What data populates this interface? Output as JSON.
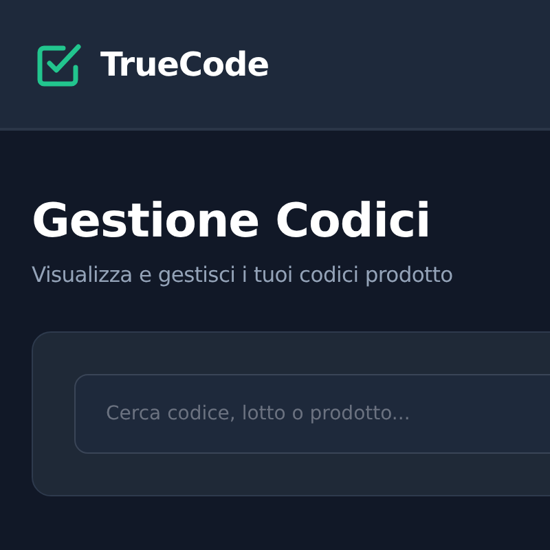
{
  "header": {
    "brand": "TrueCode"
  },
  "page": {
    "title": "Gestione Codici",
    "subtitle": "Visualizza e gestisci i tuoi codici prodotto"
  },
  "search": {
    "placeholder": "Cerca codice, lotto o prodotto..."
  }
}
